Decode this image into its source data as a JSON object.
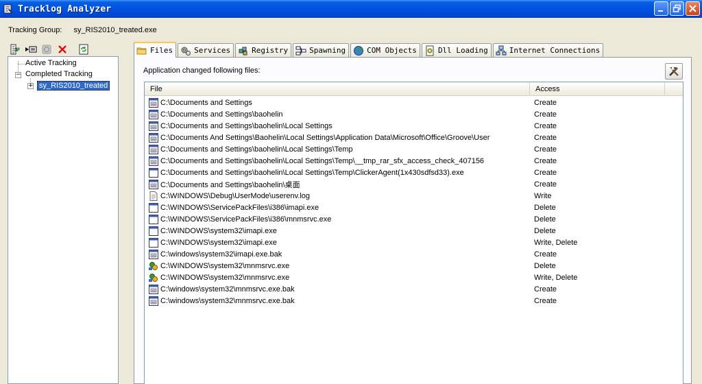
{
  "window": {
    "title": "Tracklog Analyzer",
    "controls": [
      "minimize",
      "restore",
      "close"
    ]
  },
  "group": {
    "label": "Tracking Group:",
    "value": "sy_RIS2010_treated.exe"
  },
  "toolbar": {
    "icons": [
      "tree-view-icon",
      "run-icon",
      "stop-icon",
      "delete-icon",
      "refresh-icon"
    ]
  },
  "tree": {
    "items": [
      {
        "label": "Active Tracking"
      },
      {
        "label": "Completed Tracking"
      },
      {
        "label": "sy_RIS2010_treated"
      }
    ]
  },
  "tabs": [
    {
      "label": "Files",
      "icon": "folder-icon",
      "active": true
    },
    {
      "label": "Services",
      "icon": "gears-icon",
      "active": false
    },
    {
      "label": "Registry",
      "icon": "registry-icon",
      "active": false
    },
    {
      "label": "Spawning",
      "icon": "spawning-icon",
      "active": false
    },
    {
      "label": "COM Objects",
      "icon": "globe-icon",
      "active": false
    },
    {
      "label": "Dll Loading",
      "icon": "dll-icon",
      "active": false
    },
    {
      "label": "Internet Connections",
      "icon": "network-icon",
      "active": false
    }
  ],
  "panel": {
    "caption": "Application changed following files:"
  },
  "list": {
    "columns": [
      "File",
      "Access"
    ],
    "rows": [
      {
        "file": "C:\\Documents and Settings",
        "access": "Create",
        "icon": "folder-window"
      },
      {
        "file": "C:\\Documents and Settings\\baohelin",
        "access": "Create",
        "icon": "folder-window"
      },
      {
        "file": "C:\\Documents and Settings\\baohelin\\Local Settings",
        "access": "Create",
        "icon": "folder-window"
      },
      {
        "file": "C:\\Documents And Settings\\Baohelin\\Local Settings\\Application Data\\Microsoft\\Office\\Groove\\User",
        "access": "Create",
        "icon": "folder-window"
      },
      {
        "file": "C:\\Documents and Settings\\baohelin\\Local Settings\\Temp",
        "access": "Create",
        "icon": "folder-window"
      },
      {
        "file": "C:\\Documents and Settings\\baohelin\\Local Settings\\Temp\\__tmp_rar_sfx_access_check_407156",
        "access": "Create",
        "icon": "folder-window"
      },
      {
        "file": "C:\\Documents and Settings\\baohelin\\Local Settings\\Temp\\ClickerAgent(1x430sdfsd33).exe",
        "access": "Create",
        "icon": "exe"
      },
      {
        "file": "C:\\Documents and Settings\\baohelin\\桌面",
        "access": "Create",
        "icon": "folder-window"
      },
      {
        "file": "C:\\WINDOWS\\Debug\\UserMode\\userenv.log",
        "access": "Write",
        "icon": "text"
      },
      {
        "file": "C:\\WINDOWS\\ServicePackFiles\\i386\\imapi.exe",
        "access": "Delete",
        "icon": "exe"
      },
      {
        "file": "C:\\WINDOWS\\ServicePackFiles\\i386\\mnmsrvc.exe",
        "access": "Delete",
        "icon": "exe"
      },
      {
        "file": "C:\\WINDOWS\\system32\\imapi.exe",
        "access": "Delete",
        "icon": "exe"
      },
      {
        "file": "C:\\WINDOWS\\system32\\imapi.exe",
        "access": "Write, Delete",
        "icon": "exe"
      },
      {
        "file": "C:\\windows\\system32\\imapi.exe.bak",
        "access": "Create",
        "icon": "folder-window"
      },
      {
        "file": "C:\\WINDOWS\\system32\\mnmsrvc.exe",
        "access": "Delete",
        "icon": "netmeeting"
      },
      {
        "file": "C:\\WINDOWS\\system32\\mnmsrvc.exe",
        "access": "Write, Delete",
        "icon": "netmeeting"
      },
      {
        "file": "C:\\windows\\system32\\mnmsrvc.exe.bak",
        "access": "Create",
        "icon": "folder-window"
      },
      {
        "file": "C:\\windows\\system32\\mnmsrvc.exe.bak",
        "access": "Create",
        "icon": "folder-window"
      }
    ]
  }
}
